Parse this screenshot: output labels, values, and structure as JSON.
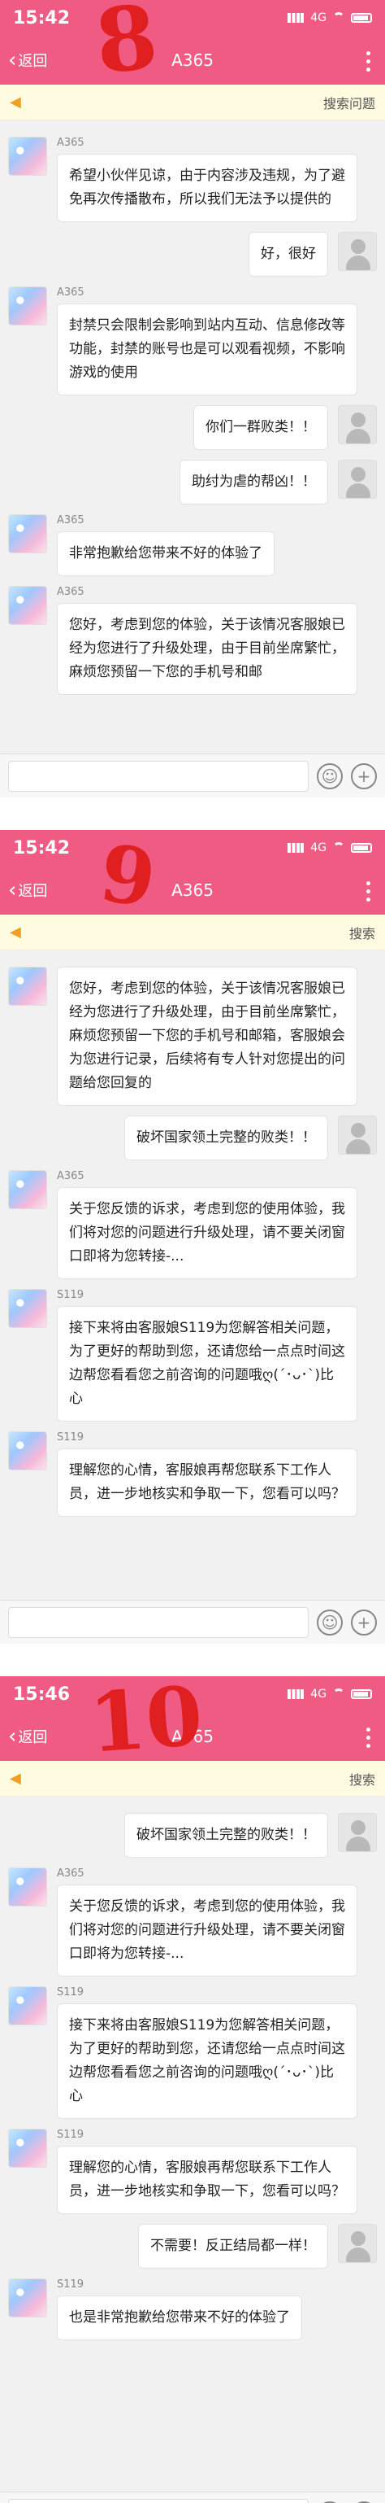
{
  "shots": [
    {
      "status": {
        "time": "15:42",
        "network": "4G"
      },
      "nav": {
        "back": "返回",
        "title": "A365"
      },
      "notice": {
        "search": "搜索问题"
      },
      "annotation": "8",
      "messages": [
        {
          "side": "left",
          "name": "A365",
          "text": "希望小伙伴见谅，由于内容涉及违规，为了避免再次传播散布，所以我们无法予以提供的"
        },
        {
          "side": "right",
          "text": "好，很好"
        },
        {
          "side": "left",
          "name": "A365",
          "text": "封禁只会限制会影响到站内互动、信息修改等功能，封禁的账号也是可以观看视频，不影响游戏的使用"
        },
        {
          "side": "right",
          "text": "你们一群败类！！"
        },
        {
          "side": "right",
          "text": "助纣为虐的帮凶！！"
        },
        {
          "side": "left",
          "name": "A365",
          "text": "非常抱歉给您带来不好的体验了"
        },
        {
          "side": "left",
          "name": "A365",
          "text": "您好，考虑到您的体验，关于该情况客服娘已经为您进行了升级处理，由于目前坐席繁忙，麻烦您预留一下您的手机号和邮"
        }
      ]
    },
    {
      "status": {
        "time": "15:42",
        "network": "4G"
      },
      "nav": {
        "back": "返回",
        "title": "A365"
      },
      "notice": {
        "search": "搜索"
      },
      "annotation": "9",
      "messages": [
        {
          "side": "left",
          "name": "",
          "text": "您好，考虑到您的体验，关于该情况客服娘已经为您进行了升级处理，由于目前坐席繁忙，麻烦您预留一下您的手机号和邮箱，客服娘会为您进行记录，后续将有专人针对您提出的问题给您回复的"
        },
        {
          "side": "right",
          "text": "破坏国家领土完整的败类！！"
        },
        {
          "side": "left",
          "name": "A365",
          "text": "关于您反馈的诉求，考虑到您的使用体验，我们将对您的问题进行升级处理，请不要关闭窗口即将为您转接-..."
        },
        {
          "side": "left",
          "name": "S119",
          "text": "接下来将由客服娘S119为您解答相关问题，为了更好的帮助到您，还请您给一点点时间这边帮您看看您之前咨询的问题哦ღ(´･ᴗ･`)比心"
        },
        {
          "side": "left",
          "name": "S119",
          "text": "理解您的心情，客服娘再帮您联系下工作人员，进一步地核实和争取一下，您看可以吗？"
        }
      ]
    },
    {
      "status": {
        "time": "15:46",
        "network": "4G"
      },
      "nav": {
        "back": "返回",
        "title": "A365"
      },
      "notice": {
        "search": "搜索"
      },
      "annotation": "10",
      "messages": [
        {
          "side": "right",
          "text": "破坏国家领土完整的败类！！"
        },
        {
          "side": "left",
          "name": "A365",
          "text": "关于您反馈的诉求，考虑到您的使用体验，我们将对您的问题进行升级处理，请不要关闭窗口即将为您转接-..."
        },
        {
          "side": "left",
          "name": "S119",
          "text": "接下来将由客服娘S119为您解答相关问题，为了更好的帮助到您，还请您给一点点时间这边帮您看看您之前咨询的问题哦ღ(´･ᴗ･`)比心"
        },
        {
          "side": "left",
          "name": "S119",
          "text": "理解您的心情，客服娘再帮您联系下工作人员，进一步地核实和争取一下，您看可以吗？"
        },
        {
          "side": "right",
          "text": "不需要！反正结局都一样！"
        },
        {
          "side": "left",
          "name": "S119",
          "text": "也是非常抱歉给您带来不好的体验了"
        }
      ]
    }
  ]
}
